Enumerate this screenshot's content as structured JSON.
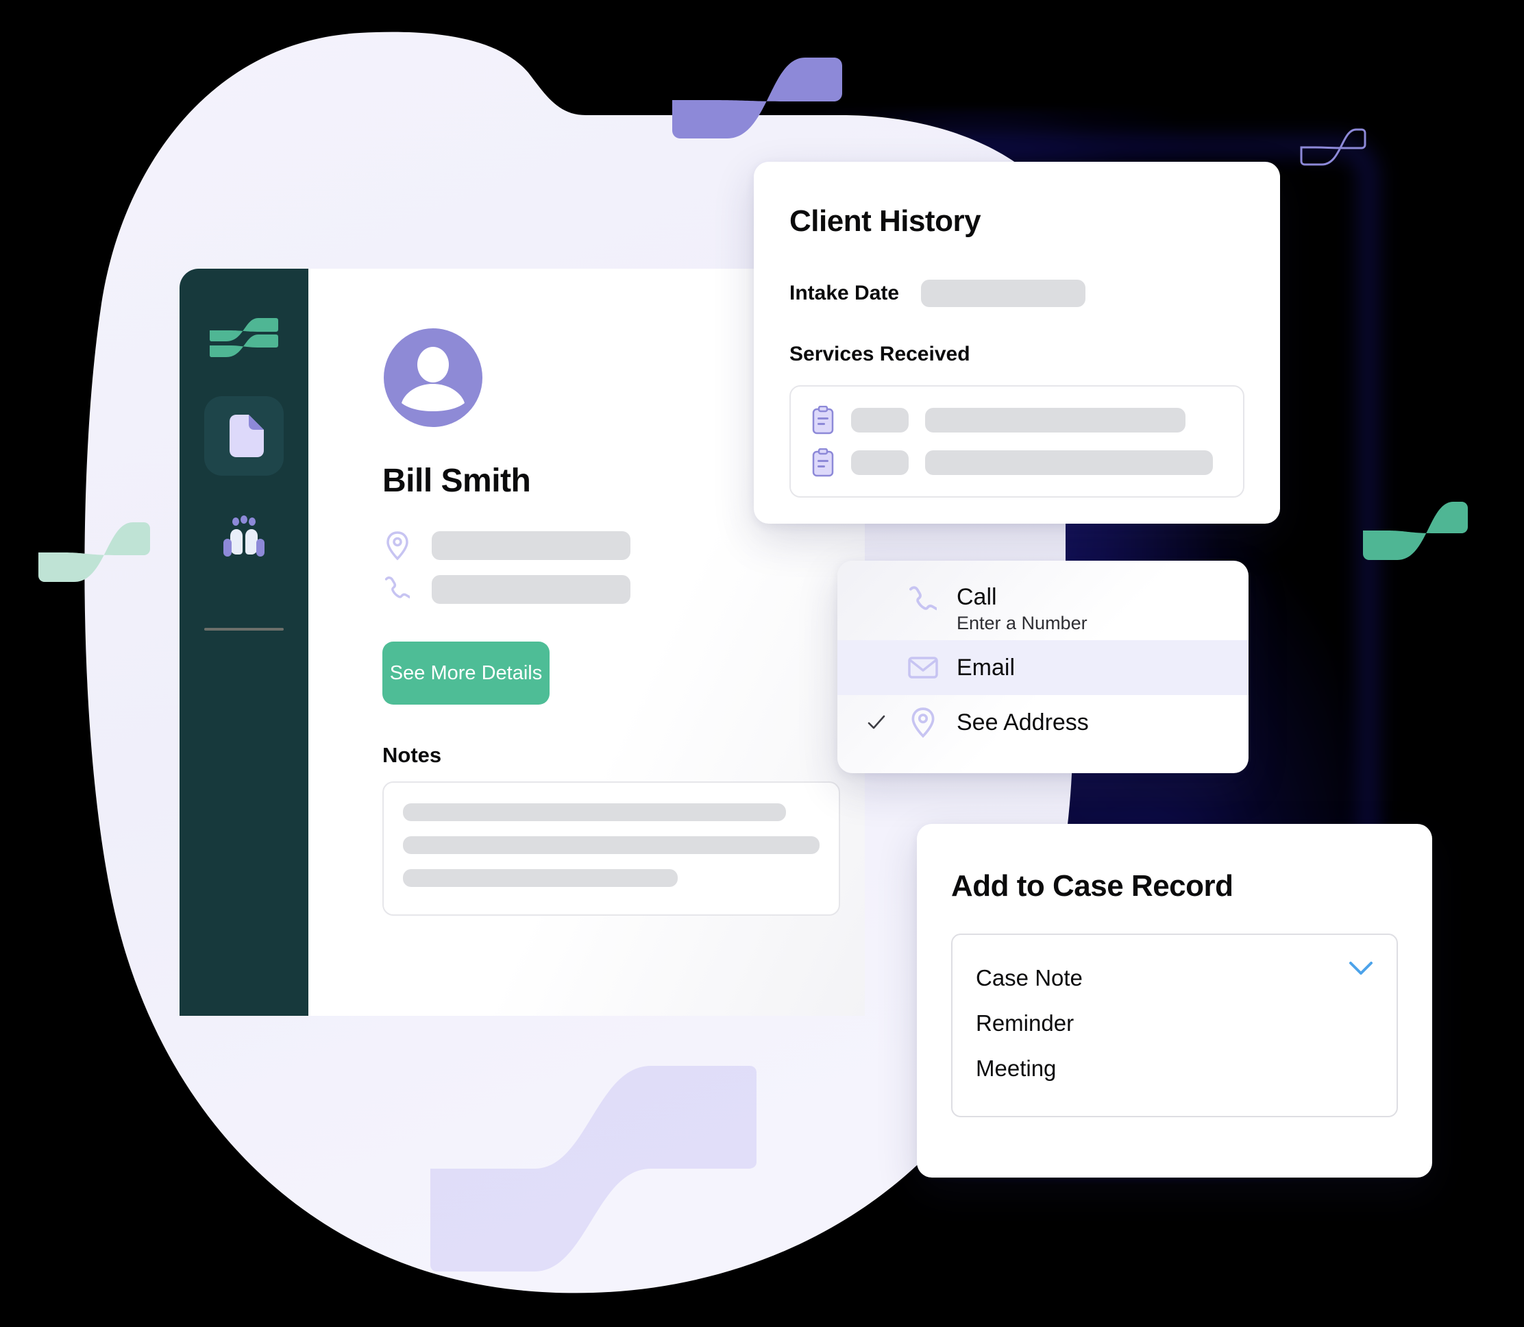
{
  "theme": {
    "sidebar_bg": "#17393c",
    "sidebar_active_bg": "#1e454a",
    "accent_green": "#4ebd96",
    "accent_purple": "#8e8ad6",
    "icon_lavender": "#c7c4f2",
    "chevron_blue": "#4da3ea",
    "skeleton_grey": "#dcdde0",
    "page_bg": "#000000",
    "blob_bg": "#f3f2fb"
  },
  "sidebar": {
    "logo": "wave-logo",
    "items": [
      {
        "icon": "document-icon",
        "name": "documents",
        "active": true
      },
      {
        "icon": "people-icon",
        "name": "clients",
        "active": false
      }
    ]
  },
  "profile": {
    "avatar_icon": "user-avatar-icon",
    "name": "Bill Smith",
    "address_icon": "location-pin-icon",
    "phone_icon": "phone-icon",
    "address_value": "",
    "phone_value": "",
    "details_button": "See More Details",
    "notes_title": "Notes",
    "notes_lines": [
      "",
      "",
      ""
    ]
  },
  "client_history": {
    "title": "Client History",
    "intake_label": "Intake Date",
    "intake_value": "",
    "services_label": "Services Received",
    "services": [
      {
        "icon": "clipboard-icon",
        "tag": "",
        "name": ""
      },
      {
        "icon": "clipboard-icon",
        "tag": "",
        "name": ""
      }
    ]
  },
  "contact_menu": {
    "items": [
      {
        "icon": "phone-icon",
        "label": "Call",
        "sublabel": "Enter a Number",
        "highlighted": false,
        "checked": false
      },
      {
        "icon": "envelope-icon",
        "label": "Email",
        "sublabel": "",
        "highlighted": true,
        "checked": false
      },
      {
        "icon": "location-pin-icon",
        "label": "See Address",
        "sublabel": "",
        "highlighted": false,
        "checked": true
      }
    ]
  },
  "case_record": {
    "title": "Add to Case Record",
    "selected": "Case Note",
    "chevron_icon": "chevron-down-icon",
    "options": [
      "Case Note",
      "Reminder",
      "Meeting"
    ]
  }
}
